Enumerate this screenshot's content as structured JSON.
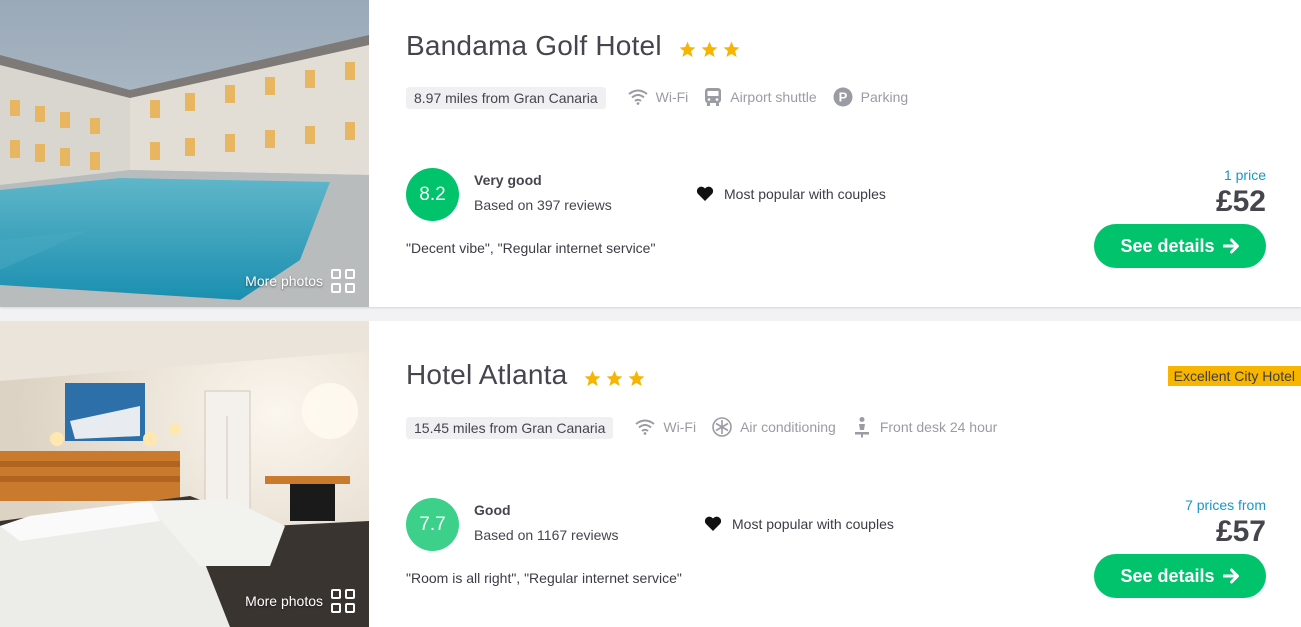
{
  "hotels": [
    {
      "name": "Bandama Golf Hotel",
      "stars": 3,
      "distance": "8.97 miles from Gran Canaria",
      "amenities": [
        {
          "label": "Wi-Fi",
          "icon": "wifi-icon"
        },
        {
          "label": "Airport shuttle",
          "icon": "bus-icon"
        },
        {
          "label": "Parking",
          "icon": "parking-icon"
        }
      ],
      "score": "8.2",
      "score_color": "#00c36b",
      "rating_label": "Very good",
      "reviews": "Based on 397 reviews",
      "popular": "Most popular with couples",
      "quote": "\"Decent vibe\", \"Regular internet service\"",
      "price_label": "1 price",
      "price": "£52",
      "button": "See details",
      "more_photos": "More photos",
      "badge": ""
    },
    {
      "name": "Hotel Atlanta",
      "stars": 3,
      "distance": "15.45 miles from Gran Canaria",
      "amenities": [
        {
          "label": "Wi-Fi",
          "icon": "wifi-icon"
        },
        {
          "label": "Air conditioning",
          "icon": "snowflake-icon"
        },
        {
          "label": "Front desk 24 hour",
          "icon": "reception-bell-icon"
        }
      ],
      "score": "7.7",
      "score_color": "#3cd08a",
      "rating_label": "Good",
      "reviews": "Based on 1167 reviews",
      "popular": "Most popular with couples",
      "quote": "\"Room is all right\", \"Regular internet service\"",
      "price_label": "7 prices from",
      "price": "£57",
      "button": "See details",
      "more_photos": "More photos",
      "badge": "Excellent City Hotel"
    }
  ]
}
